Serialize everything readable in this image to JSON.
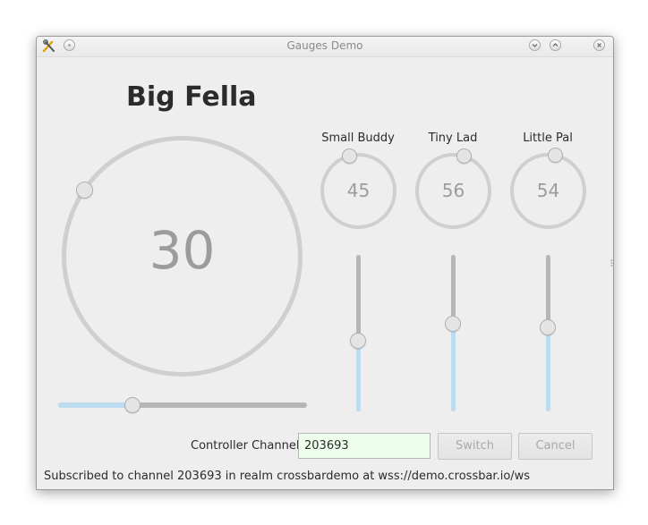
{
  "window": {
    "title": "Gauges Demo"
  },
  "big_gauge": {
    "label": "Big Fella",
    "value": "30",
    "slider_value": 30,
    "slider_max": 100
  },
  "small_gauges": [
    {
      "label": "Small Buddy",
      "value": "45",
      "slider_value": 45,
      "slider_max": 100
    },
    {
      "label": "Tiny Lad",
      "value": "56",
      "slider_value": 56,
      "slider_max": 100
    },
    {
      "label": "Little Pal",
      "value": "54",
      "slider_value": 54,
      "slider_max": 100
    }
  ],
  "controls": {
    "channel_label": "Controller Channel:",
    "channel_value": "203693",
    "switch_label": "Switch",
    "cancel_label": "Cancel"
  },
  "status": {
    "text": "Subscribed to channel 203693 in realm crossbardemo at wss://demo.crossbar.io/ws"
  },
  "colors": {
    "dial": "#cfcfcf",
    "value_text": "#9c9c9c",
    "slider_track": "#b6b6b6",
    "slider_fill": "#bcdcf2",
    "input_bg": "#edfeed"
  }
}
